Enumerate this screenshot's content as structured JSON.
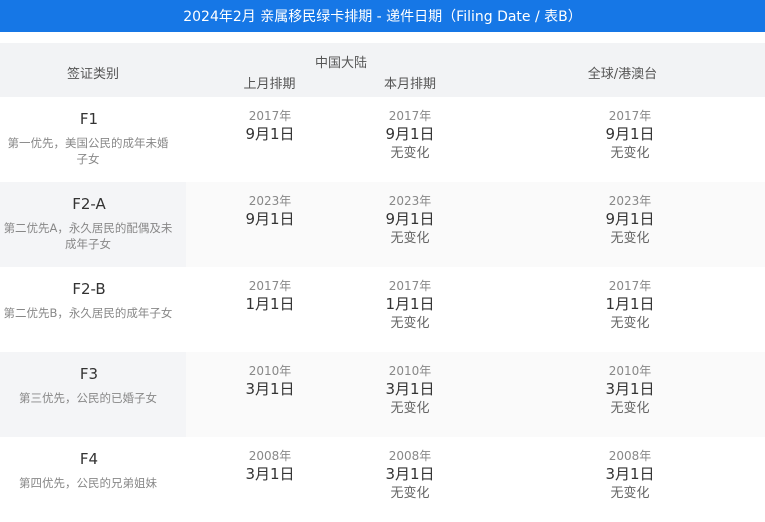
{
  "title": "2024年2月 亲属移民绿卡排期 - 递件日期（Filing Date / 表B）",
  "header": {
    "category": "签证类别",
    "china": "中国大陆",
    "last_month": "上月排期",
    "this_month": "本月排期",
    "global": "全球/港澳台"
  },
  "rows": [
    {
      "code": "F1",
      "desc": "第一优先，美国公民的成年未婚子女",
      "last": {
        "year": "2017年",
        "md": "9月1日"
      },
      "this": {
        "year": "2017年",
        "md": "9月1日",
        "change": "无变化"
      },
      "global": {
        "year": "2017年",
        "md": "9月1日",
        "change": "无变化"
      }
    },
    {
      "code": "F2-A",
      "desc": "第二优先A，永久居民的配偶及未成年子女",
      "last": {
        "year": "2023年",
        "md": "9月1日"
      },
      "this": {
        "year": "2023年",
        "md": "9月1日",
        "change": "无变化"
      },
      "global": {
        "year": "2023年",
        "md": "9月1日",
        "change": "无变化"
      }
    },
    {
      "code": "F2-B",
      "desc": "第二优先B，永久居民的成年子女",
      "last": {
        "year": "2017年",
        "md": "1月1日"
      },
      "this": {
        "year": "2017年",
        "md": "1月1日",
        "change": "无变化"
      },
      "global": {
        "year": "2017年",
        "md": "1月1日",
        "change": "无变化"
      }
    },
    {
      "code": "F3",
      "desc": "第三优先，公民的已婚子女",
      "last": {
        "year": "2010年",
        "md": "3月1日"
      },
      "this": {
        "year": "2010年",
        "md": "3月1日",
        "change": "无变化"
      },
      "global": {
        "year": "2010年",
        "md": "3月1日",
        "change": "无变化"
      }
    },
    {
      "code": "F4",
      "desc": "第四优先，公民的兄弟姐妹",
      "last": {
        "year": "2008年",
        "md": "3月1日"
      },
      "this": {
        "year": "2008年",
        "md": "3月1日",
        "change": "无变化"
      },
      "global": {
        "year": "2008年",
        "md": "3月1日",
        "change": "无变化"
      }
    }
  ]
}
